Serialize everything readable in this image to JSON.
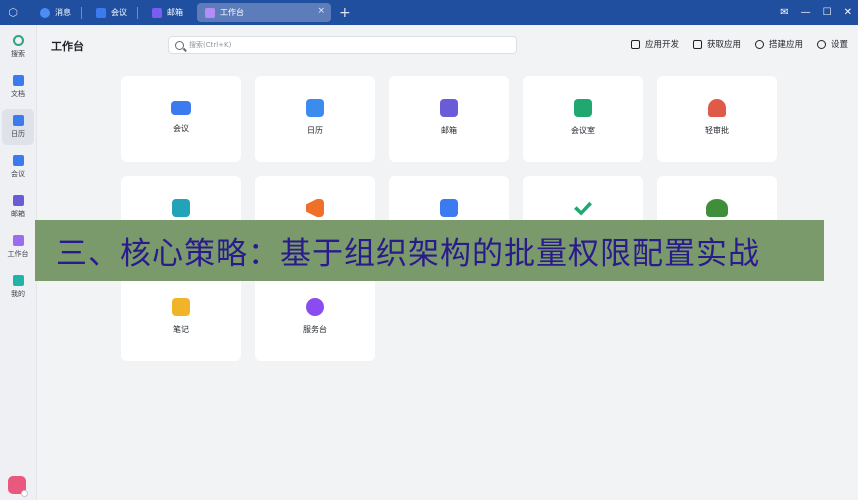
{
  "titlebar": {
    "tabs": [
      {
        "label": "消息",
        "icon": "chat-bubbles-icon",
        "color": "#4d8cf5"
      },
      {
        "label": "会议",
        "icon": "video-camera-icon",
        "color": "#3c7af0"
      },
      {
        "label": "邮箱",
        "icon": "mailbox-icon",
        "color": "#7a5cf0"
      }
    ],
    "active_tab": {
      "label": "工作台",
      "icon": "workbench-icon",
      "color": "#9b6cf0",
      "close": "×"
    },
    "plus": "+",
    "window_controls": {
      "chat": "✉",
      "min": "—",
      "max": "☐",
      "close": "✕"
    }
  },
  "rail": {
    "items": [
      {
        "label": "搜索",
        "icon": "search-icon",
        "color": "#2aa87a"
      },
      {
        "label": "文档",
        "icon": "document-icon",
        "color": "#3c7af0"
      },
      {
        "label": "日历",
        "icon": "calendar-icon",
        "color": "#3c7af0"
      },
      {
        "label": "会议",
        "icon": "video-camera-icon",
        "color": "#3c7af0"
      },
      {
        "label": "邮箱",
        "icon": "mailbox-icon",
        "color": "#6a5cd6"
      },
      {
        "label": "工作台",
        "icon": "workbench-icon",
        "color": "#9b6cf0"
      },
      {
        "label": "我的",
        "icon": "user-cube-icon",
        "color": "#20b3a8"
      }
    ],
    "active_index": 2
  },
  "header": {
    "title": "工作台",
    "search_placeholder": "搜索(Ctrl+K)",
    "actions": [
      {
        "label": "应用开发",
        "icon": "app-develop-icon"
      },
      {
        "label": "获取应用",
        "icon": "get-app-icon"
      },
      {
        "label": "搭建应用",
        "icon": "build-app-icon"
      },
      {
        "label": "设置",
        "icon": "gear-icon"
      }
    ]
  },
  "apps": [
    {
      "label": "会议",
      "icon": "video-camera-icon",
      "color": "#3c7af0"
    },
    {
      "label": "日历",
      "icon": "calendar-icon",
      "color": "#3c8cf0"
    },
    {
      "label": "邮箱",
      "icon": "mailbox-icon",
      "color": "#6a5cd6"
    },
    {
      "label": "会议室",
      "icon": "meeting-room-icon",
      "color": "#20a870"
    },
    {
      "label": "轻审批",
      "icon": "stamp-icon",
      "color": "#e05a4a"
    },
    {
      "label": "",
      "icon": "printer-icon",
      "color": "#22a3b8"
    },
    {
      "label": "",
      "icon": "megaphone-icon",
      "color": "#f0702a"
    },
    {
      "label": "",
      "icon": "notes-edit-icon",
      "color": "#3c7af0"
    },
    {
      "label": "",
      "icon": "check-icon",
      "color": "#20a870"
    },
    {
      "label": "",
      "icon": "team-icon",
      "color": "#3f8f3a"
    },
    {
      "label": "笔记",
      "icon": "notebook-icon",
      "color": "#f0b429"
    },
    {
      "label": "服务台",
      "icon": "service-agent-icon",
      "color": "#8a4cf0"
    }
  ],
  "banner": {
    "text": "三、核心策略：基于组织架构的批量权限配置实战",
    "bg_color": "#7a9a6c",
    "text_color": "#2a1b8c"
  }
}
